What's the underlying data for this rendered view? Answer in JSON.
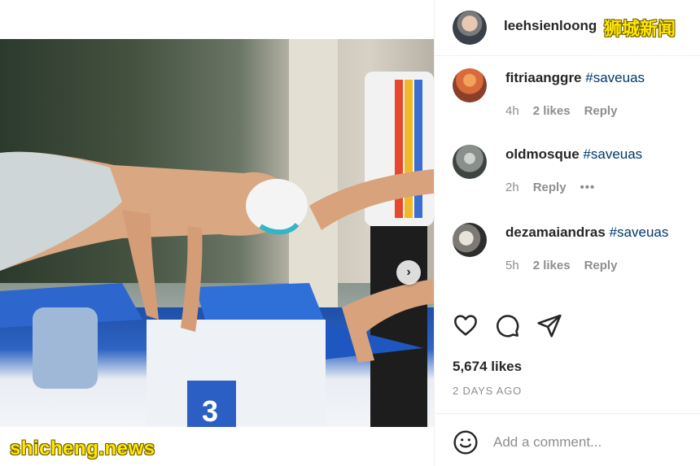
{
  "post": {
    "username": "leehsienloong",
    "watermark_top": "狮城新闻",
    "watermark_bottom": "shicheng.news"
  },
  "comments": [
    {
      "username": "fitriaanggre",
      "hashtag": "#saveuas",
      "time": "4h",
      "likes": "2 likes",
      "reply": "Reply"
    },
    {
      "username": "oldmosque",
      "hashtag": "#saveuas",
      "time": "2h",
      "likes": "",
      "reply": "Reply",
      "more": "•••"
    },
    {
      "username": "dezamaiandras",
      "hashtag": "#saveuas",
      "time": "5h",
      "likes": "2 likes",
      "reply": "Reply"
    }
  ],
  "engagement": {
    "likes": "5,674 likes",
    "timestamp": "2 DAYS AGO"
  },
  "add_comment": {
    "placeholder": "Add a comment..."
  },
  "icons": {
    "like": "heart-icon",
    "comment": "comment-bubble-icon",
    "share": "send-icon",
    "emoji": "emoji-icon",
    "next": "chevron-right-icon"
  },
  "carousel": {
    "active_index": 1,
    "count": 2
  },
  "colors": {
    "watermark": "#ffe600",
    "hashtag": "#00376b",
    "muted": "#8e8e8e"
  }
}
